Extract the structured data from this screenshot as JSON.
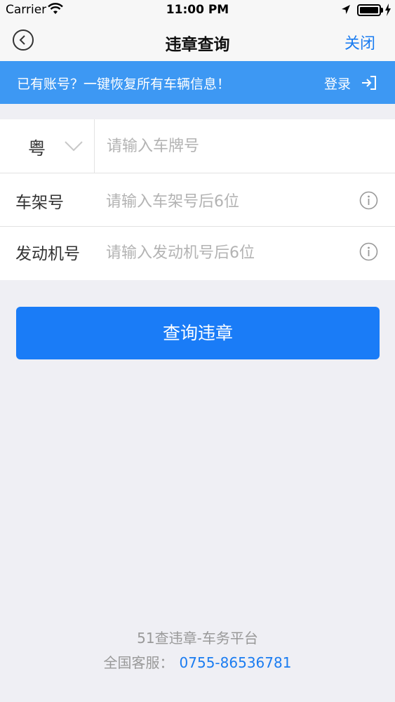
{
  "status_bar": {
    "carrier": "Carrier",
    "time": "11:00 PM",
    "icons": [
      "wifi-icon",
      "location-arrow-icon",
      "battery-icon",
      "charging-bolt-icon"
    ]
  },
  "nav": {
    "title": "违章查询",
    "close_label": "关闭",
    "back_icon": "back-circle-icon"
  },
  "banner": {
    "text": "已有账号？一键恢复所有车辆信息！",
    "login_label": "登录",
    "login_icon": "login-arrow-icon"
  },
  "form": {
    "province": "粤",
    "plate_placeholder": "请输入车牌号",
    "vin_label": "车架号",
    "vin_placeholder": "请输入车架号后6位",
    "engine_label": "发动机号",
    "engine_placeholder": "请输入发动机号后6位"
  },
  "submit_label": "查询违章",
  "footer": {
    "brand": "51查违章-车务平台",
    "service_label": "全国客服：",
    "phone": "0755-86536781"
  },
  "colors": {
    "accent": "#1a7cf7",
    "banner": "#3d98f3",
    "background": "#efeff4"
  }
}
